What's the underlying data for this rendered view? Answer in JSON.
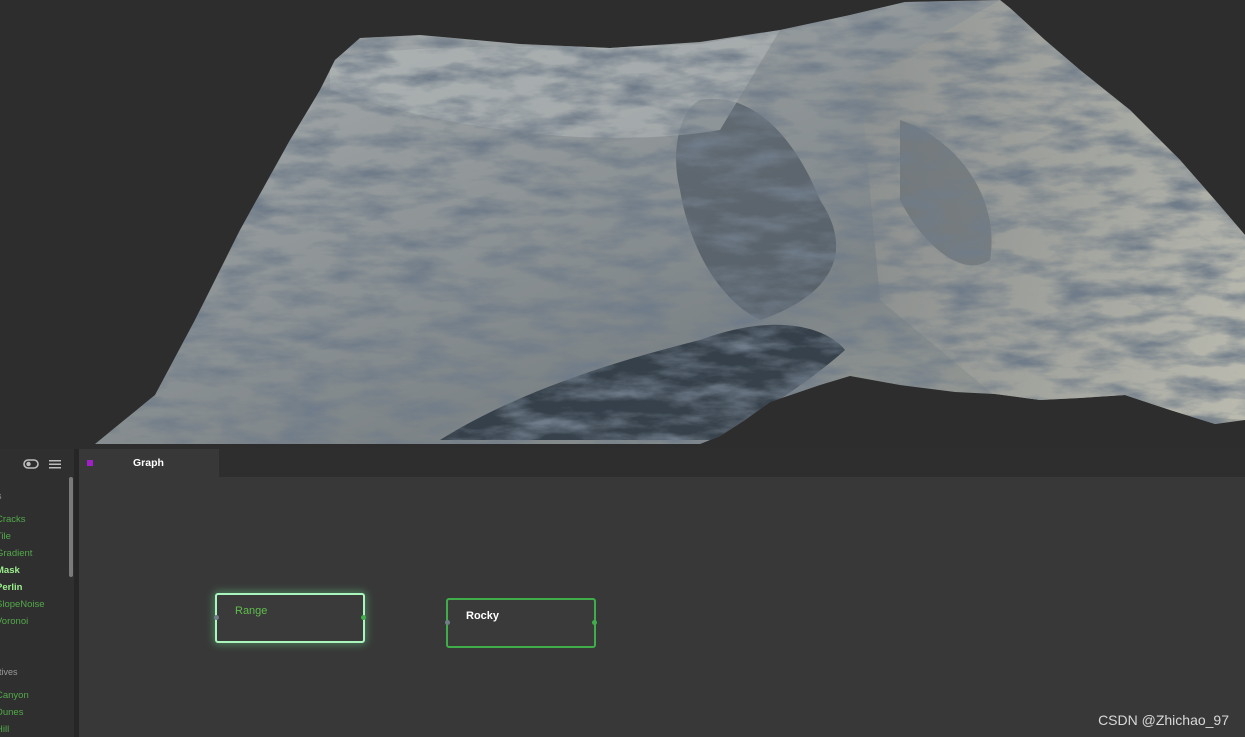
{
  "sidebar": {
    "toolbar_icons": [
      "toggle-icon",
      "menu-icon"
    ],
    "categories": [
      {
        "label": "s",
        "items": [
          {
            "label": "Cracks",
            "active": false
          },
          {
            "label": "Tile",
            "active": false
          },
          {
            "label": "Gradient",
            "active": false
          },
          {
            "label": "Mask",
            "active": true
          },
          {
            "label": "Perlin",
            "active": true
          },
          {
            "label": "SlopeNoise",
            "active": false
          },
          {
            "label": "Voronoi",
            "active": false
          }
        ]
      },
      {
        "label": "itives",
        "items": [
          {
            "label": "Canyon",
            "active": false
          },
          {
            "label": "Dunes",
            "active": false
          },
          {
            "label": "Hill",
            "active": false
          }
        ]
      }
    ]
  },
  "graph": {
    "tab_label": "Graph",
    "tab_color": "#a020c8",
    "nodes": [
      {
        "title": "Range",
        "selected": true
      },
      {
        "title": "Rocky",
        "selected": false
      }
    ]
  },
  "colors": {
    "node_border": "#3fae4a",
    "node_selected_border": "#a9f5bd",
    "item_text": "#53a84a",
    "item_active_text": "#9cf08e",
    "terrain_light": "#b5b8b0",
    "terrain_shadow": "#283440"
  },
  "watermark": "CSDN @Zhichao_97"
}
